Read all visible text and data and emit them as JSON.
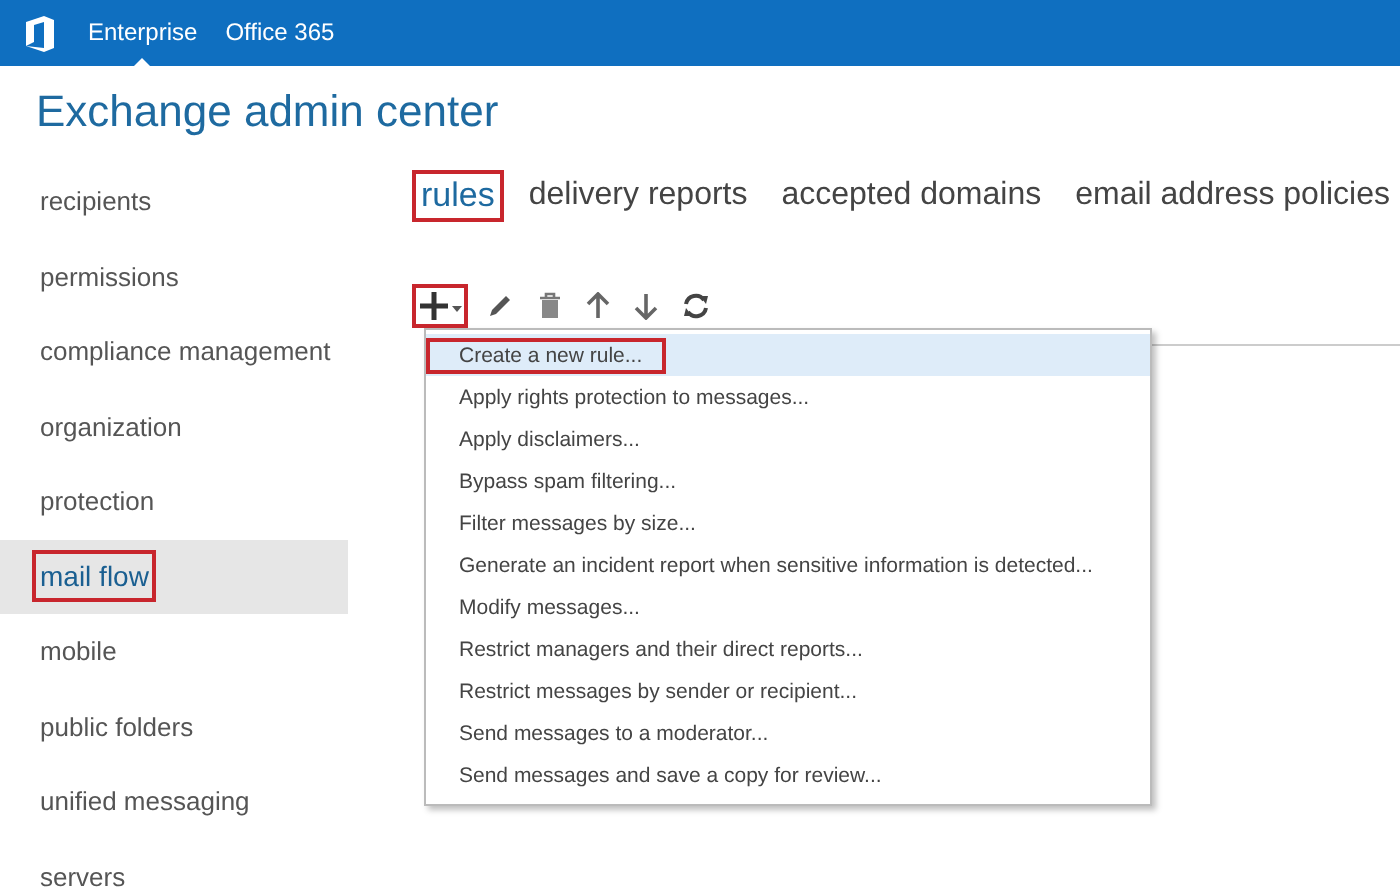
{
  "top_bar": {
    "items": [
      {
        "label": "Enterprise",
        "selected": true
      },
      {
        "label": "Office 365",
        "selected": false
      }
    ]
  },
  "title": "Exchange admin center",
  "sidebar": {
    "items": [
      {
        "label": "recipients",
        "selected": false,
        "annotated": false
      },
      {
        "label": "permissions",
        "selected": false,
        "annotated": false
      },
      {
        "label": "compliance management",
        "selected": false,
        "annotated": false
      },
      {
        "label": "organization",
        "selected": false,
        "annotated": false
      },
      {
        "label": "protection",
        "selected": false,
        "annotated": false
      },
      {
        "label": "mail flow",
        "selected": true,
        "annotated": true
      },
      {
        "label": "mobile",
        "selected": false,
        "annotated": false
      },
      {
        "label": "public folders",
        "selected": false,
        "annotated": false
      },
      {
        "label": "unified messaging",
        "selected": false,
        "annotated": false
      },
      {
        "label": "servers",
        "selected": false,
        "annotated": false
      }
    ]
  },
  "tabs": [
    {
      "label": "rules",
      "selected": true,
      "annotated": true
    },
    {
      "label": "delivery reports",
      "selected": false,
      "annotated": false
    },
    {
      "label": "accepted domains",
      "selected": false,
      "annotated": false
    },
    {
      "label": "email address policies",
      "selected": false,
      "annotated": false
    }
  ],
  "toolbar": [
    {
      "kind": "add",
      "annotated": true
    },
    {
      "kind": "edit",
      "annotated": false
    },
    {
      "kind": "delete",
      "annotated": false
    },
    {
      "kind": "up",
      "annotated": false
    },
    {
      "kind": "down",
      "annotated": false
    },
    {
      "kind": "refresh",
      "annotated": false
    }
  ],
  "menu": {
    "items": [
      {
        "label": "Create a new rule...",
        "selected": true,
        "annotated": true
      },
      {
        "label": "Apply rights protection to messages...",
        "selected": false,
        "annotated": false
      },
      {
        "label": "Apply disclaimers...",
        "selected": false,
        "annotated": false
      },
      {
        "label": "Bypass spam filtering...",
        "selected": false,
        "annotated": false
      },
      {
        "label": "Filter messages by size...",
        "selected": false,
        "annotated": false
      },
      {
        "label": "Generate an incident report when sensitive information is detected...",
        "selected": false,
        "annotated": false
      },
      {
        "label": "Modify messages...",
        "selected": false,
        "annotated": false
      },
      {
        "label": "Restrict managers and their direct reports...",
        "selected": false,
        "annotated": false
      },
      {
        "label": "Restrict messages by sender or recipient...",
        "selected": false,
        "annotated": false
      },
      {
        "label": "Send messages to a moderator...",
        "selected": false,
        "annotated": false
      },
      {
        "label": "Send messages and save a copy for review...",
        "selected": false,
        "annotated": false
      }
    ]
  }
}
